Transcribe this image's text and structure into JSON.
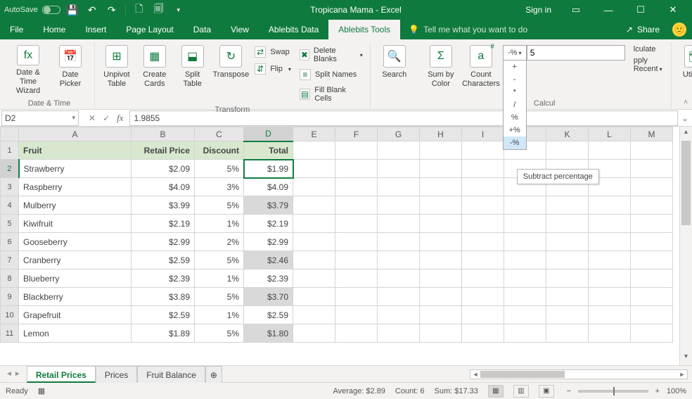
{
  "titlebar": {
    "autosave_label": "AutoSave",
    "autosave_state": "Off",
    "title": "Tropicana Mama  -  Excel",
    "signin": "Sign in"
  },
  "tabs": {
    "items": [
      "File",
      "Home",
      "Insert",
      "Page Layout",
      "Data",
      "View",
      "Ablebits Data",
      "Ablebits Tools"
    ],
    "active": "Ablebits Tools",
    "tellme": "Tell me what you want to do",
    "share": "Share"
  },
  "ribbon": {
    "datetime": {
      "wizard": "Date &\nTime Wizard",
      "picker": "Date\nPicker",
      "group": "Date & Time"
    },
    "transform": {
      "unpivot": "Unpivot\nTable",
      "cards": "Create\nCards",
      "split": "Split\nTable",
      "transpose": "Transpose",
      "swap": "Swap",
      "flip": "Flip",
      "deleteblanks": "Delete Blanks",
      "splitnames": "Split Names",
      "fillblank": "Fill Blank Cells",
      "group": "Transform"
    },
    "search": "Search",
    "sumby": "Sum by\nColor",
    "countchars": "Count\nCharacters",
    "calcgroup": "Calcul",
    "calc": {
      "selected": "-%",
      "input": "5",
      "options": [
        "+",
        "-",
        "*",
        "/",
        "%",
        "+%",
        "-%"
      ],
      "lculate": "lculate",
      "applyrecent": "pply Recent",
      "tooltip": "Subtract percentage"
    },
    "utilities": "Utilities"
  },
  "namebox": "D2",
  "formula": "1.9855",
  "grid": {
    "columns": [
      "A",
      "B",
      "C",
      "D",
      "E",
      "F",
      "G",
      "H",
      "I",
      "J",
      "K",
      "L",
      "M"
    ],
    "headers": {
      "fruit": "Fruit",
      "price": "Retail Price",
      "discount": "Discount",
      "total": "Total"
    },
    "rows": [
      {
        "n": 2,
        "fruit": "Strawberry",
        "price": "$2.09",
        "disc": "5%",
        "total": "$1.99",
        "sel": true
      },
      {
        "n": 3,
        "fruit": "Raspberry",
        "price": "$4.09",
        "disc": "3%",
        "total": "$4.09"
      },
      {
        "n": 4,
        "fruit": "Mulberry",
        "price": "$3.99",
        "disc": "5%",
        "total": "$3.79",
        "hi": true
      },
      {
        "n": 5,
        "fruit": "Kiwifruit",
        "price": "$2.19",
        "disc": "1%",
        "total": "$2.19"
      },
      {
        "n": 6,
        "fruit": "Gooseberry",
        "price": "$2.99",
        "disc": "2%",
        "total": "$2.99"
      },
      {
        "n": 7,
        "fruit": "Cranberry",
        "price": "$2.59",
        "disc": "5%",
        "total": "$2.46",
        "hi": true
      },
      {
        "n": 8,
        "fruit": "Blueberry",
        "price": "$2.39",
        "disc": "1%",
        "total": "$2.39"
      },
      {
        "n": 9,
        "fruit": "Blackberry",
        "price": "$3.89",
        "disc": "5%",
        "total": "$3.70",
        "hi": true
      },
      {
        "n": 10,
        "fruit": "Grapefruit",
        "price": "$2.59",
        "disc": "1%",
        "total": "$2.59"
      },
      {
        "n": 11,
        "fruit": "Lemon",
        "price": "$1.89",
        "disc": "5%",
        "total": "$1.80",
        "hi": true
      }
    ]
  },
  "sheets": {
    "items": [
      "Retail Prices",
      "Prices",
      "Fruit Balance"
    ],
    "active": "Retail Prices"
  },
  "status": {
    "ready": "Ready",
    "avg": "Average: $2.89",
    "count": "Count: 6",
    "sum": "Sum: $17.33",
    "zoom": "100%"
  }
}
